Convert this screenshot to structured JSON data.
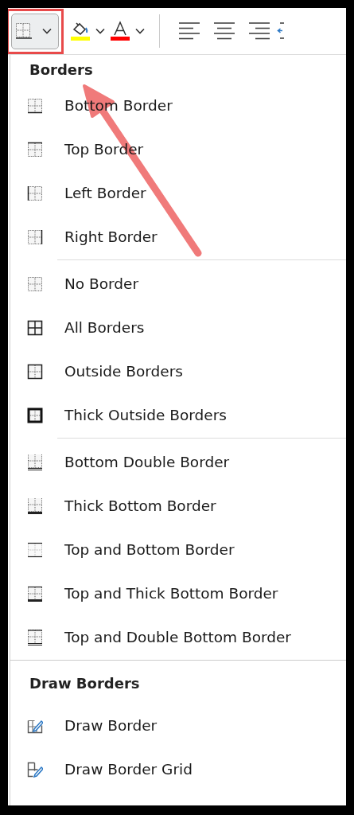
{
  "toolbar": {
    "border_button": {
      "highlighted": true
    },
    "fill_color": {
      "color": "#ffff00"
    },
    "font_color": {
      "color": "#ff0000"
    }
  },
  "sections": [
    {
      "heading": "Borders",
      "groups": [
        [
          {
            "label": "Bottom Border"
          },
          {
            "label": "Top Border"
          },
          {
            "label": "Left Border"
          },
          {
            "label": "Right Border"
          }
        ],
        [
          {
            "label": "No Border"
          },
          {
            "label": "All Borders"
          },
          {
            "label": "Outside Borders"
          },
          {
            "label": "Thick Outside Borders"
          }
        ],
        [
          {
            "label": "Bottom Double Border"
          },
          {
            "label": "Thick Bottom Border"
          },
          {
            "label": "Top and Bottom Border"
          },
          {
            "label": "Top and Thick Bottom Border"
          },
          {
            "label": "Top and Double Bottom Border"
          }
        ]
      ]
    },
    {
      "heading": "Draw Borders",
      "groups": [
        [
          {
            "label": "Draw Border"
          },
          {
            "label": "Draw Border Grid"
          }
        ]
      ]
    }
  ],
  "annotation": {
    "kind": "arrow"
  }
}
